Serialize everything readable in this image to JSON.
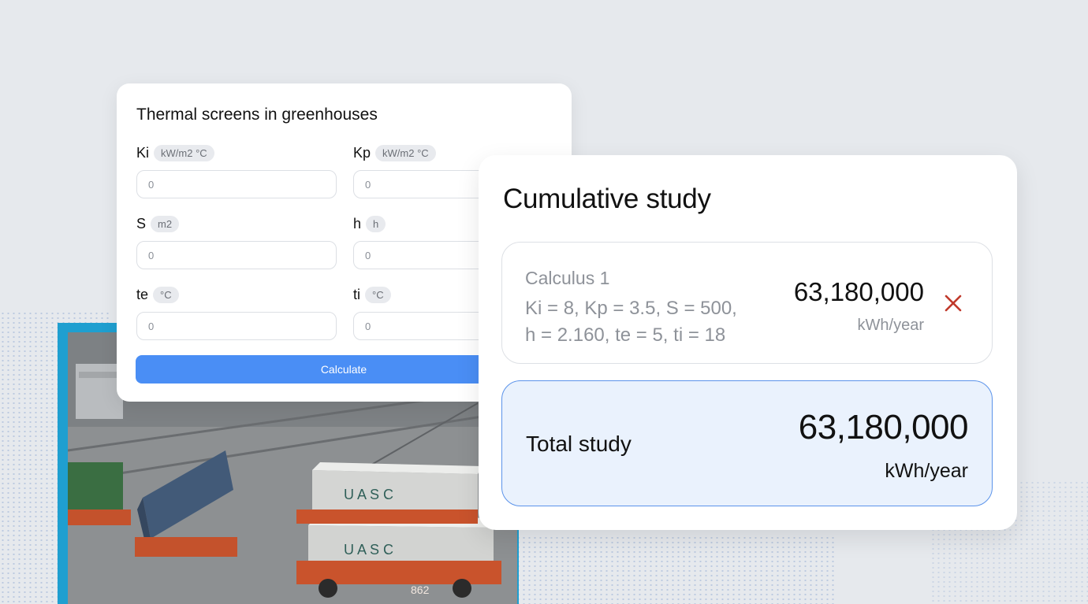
{
  "form": {
    "title": "Thermal screens in greenhouses",
    "fields": {
      "ki": {
        "label": "Ki",
        "unit": "kW/m2 °C",
        "value": "0"
      },
      "kp": {
        "label": "Kp",
        "unit": "kW/m2 °C",
        "value": "0"
      },
      "s": {
        "label": "S",
        "unit": "m2",
        "value": "0"
      },
      "h": {
        "label": "h",
        "unit": "h",
        "value": "0"
      },
      "te": {
        "label": "te",
        "unit": "°C",
        "value": "0"
      },
      "ti": {
        "label": "ti",
        "unit": "°C",
        "value": "0"
      }
    },
    "calculate_label": "Calculate",
    "button_color": "#4a8ef5"
  },
  "study": {
    "title": "Cumulative study",
    "items": [
      {
        "name": "Calculus 1",
        "params_line1": "Ki = 8, Kp = 3.5, S = 500,",
        "params_line2": "h = 2.160, te = 5, ti = 18",
        "value": "63,180,000",
        "unit": "kWh/year",
        "remove_icon": "close-icon",
        "remove_color": "#c0392b"
      }
    ],
    "total": {
      "label": "Total study",
      "value": "63,180,000",
      "unit": "kWh/year"
    }
  },
  "photo": {
    "container_text_1": "U A S C",
    "container_text_2": "U A S C",
    "vehicle_number": "862"
  }
}
